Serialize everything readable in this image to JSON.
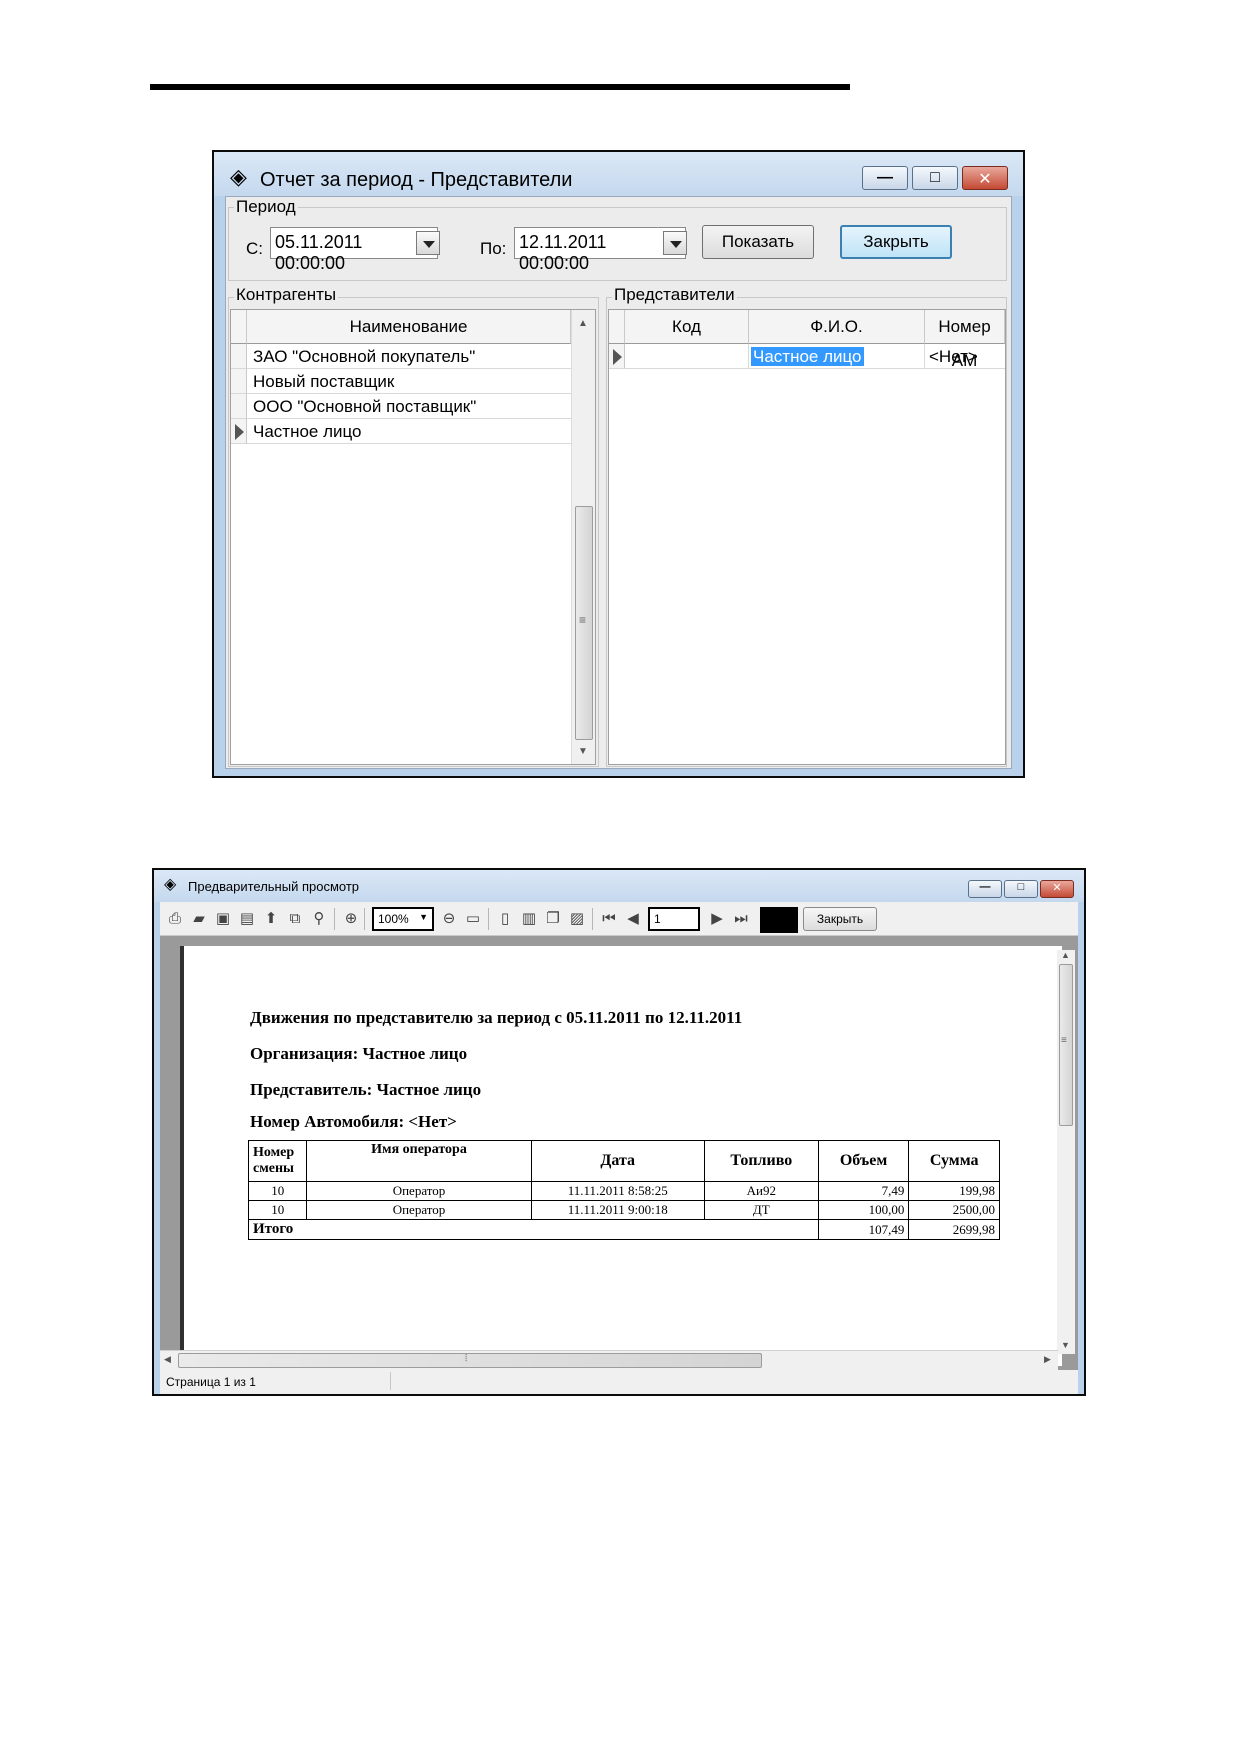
{
  "window1": {
    "title": "Отчет за период - Представители",
    "period_group": "Период",
    "from_label": "С:",
    "from_value": "05.11.2011 00:00:00",
    "to_label": "По:",
    "to_value": "12.11.2011 00:00:00",
    "show_button": "Показать",
    "close_button": "Закрыть",
    "contractors": {
      "group_label": "Контрагенты",
      "column": "Наименование",
      "rows": [
        "ЗАО \"Основной покупатель\"",
        "Новый поставщик",
        "ООО \"Основной поставщик\"",
        "Частное лицо"
      ]
    },
    "representatives": {
      "group_label": "Представители",
      "columns": [
        "Код",
        "Ф.И.О.",
        "Номер АМ"
      ],
      "rows": [
        {
          "code": "",
          "name": "Частное лицо",
          "car": "<Нет>"
        }
      ]
    }
  },
  "window2": {
    "title": "Предварительный просмотр",
    "zoom": "100%",
    "page": "1",
    "close_button": "Закрыть",
    "status": "Страница 1 из 1",
    "report": {
      "title": "Движения по представителю за период с 05.11.2011 по 12.11.2011",
      "org": "Организация: Частное лицо",
      "rep": "Представитель: Частное лицо",
      "car": "Номер Автомобиля: <Нет>",
      "headers": [
        "Номер смены",
        "Имя оператора",
        "Дата",
        "Топливо",
        "Объем",
        "Сумма"
      ],
      "rows": [
        [
          "10",
          "Оператор",
          "11.11.2011 8:58:25",
          "Аи92",
          "7,49",
          "199,98"
        ],
        [
          "10",
          "Оператор",
          "11.11.2011 9:00:18",
          "ДТ",
          "100,00",
          "2500,00"
        ]
      ],
      "total_label": "Итого",
      "total_volume": "107,49",
      "total_sum": "2699,98"
    }
  }
}
